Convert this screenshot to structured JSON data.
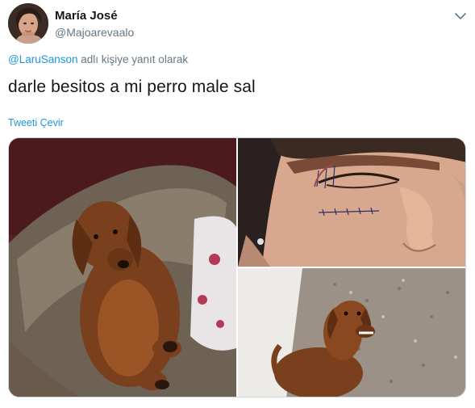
{
  "tweet": {
    "author": {
      "display_name": "María José",
      "handle": "@Majoarevaalo",
      "avatar_icon": "avatar-photo"
    },
    "reply_context": {
      "mention": "@LaruSanson",
      "suffix": " adlı kişiye yanıt olarak"
    },
    "text": "darle besitos a mi perro male sal",
    "translate_label": "Tweeti Çevir",
    "menu_icon": "chevron-down-icon",
    "media_count": 3
  },
  "colors": {
    "link": "#1b95e0",
    "secondary_text": "#657786",
    "primary_text": "#14171a",
    "border": "#ccd6dd"
  }
}
